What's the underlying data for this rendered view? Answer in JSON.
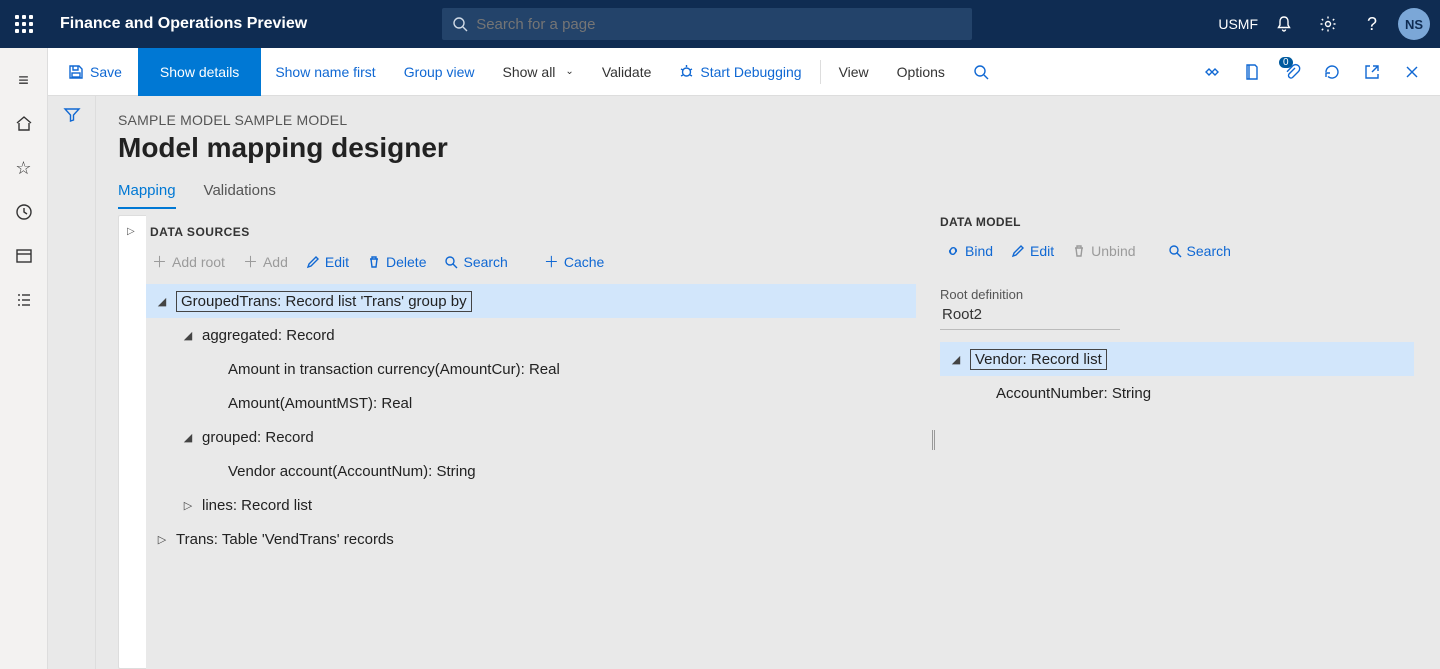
{
  "header": {
    "app_title": "Finance and Operations Preview",
    "search_placeholder": "Search for a page",
    "company": "USMF",
    "avatar_initials": "NS"
  },
  "actionbar": {
    "save": "Save",
    "show_details": "Show details",
    "show_name_first": "Show name first",
    "group_view": "Group view",
    "show_all": "Show all",
    "validate": "Validate",
    "start_debugging": "Start Debugging",
    "view": "View",
    "options": "Options",
    "badge": "0"
  },
  "page": {
    "breadcrumb": "SAMPLE MODEL SAMPLE MODEL",
    "title": "Model mapping designer",
    "tabs": {
      "mapping": "Mapping",
      "validations": "Validations"
    }
  },
  "data_sources": {
    "heading": "DATA SOURCES",
    "toolbar": {
      "add_root": "Add root",
      "add": "Add",
      "edit": "Edit",
      "delete": "Delete",
      "search": "Search",
      "cache": "Cache"
    },
    "nodes": {
      "groupedtrans": "GroupedTrans: Record list 'Trans' group by",
      "aggregated": "aggregated: Record",
      "amountcur": "Amount in transaction currency(AmountCur): Real",
      "amountmst": "Amount(AmountMST): Real",
      "grouped": "grouped: Record",
      "accountnum": "Vendor account(AccountNum): String",
      "lines": "lines: Record list",
      "trans": "Trans: Table 'VendTrans' records"
    }
  },
  "data_model": {
    "heading": "DATA MODEL",
    "toolbar": {
      "bind": "Bind",
      "edit": "Edit",
      "unbind": "Unbind",
      "search": "Search"
    },
    "root_label": "Root definition",
    "root_value": "Root2",
    "nodes": {
      "vendor": "Vendor: Record list",
      "accountnumber": "AccountNumber: String"
    }
  }
}
